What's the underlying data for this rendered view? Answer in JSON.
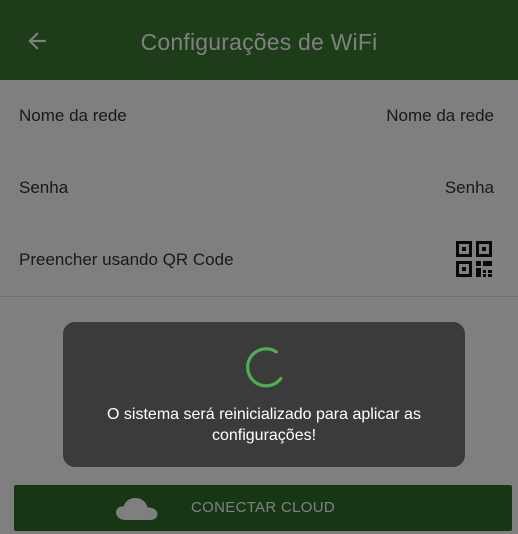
{
  "app_bar": {
    "title": "Configurações de WiFi",
    "back_icon": "arrow-left-icon"
  },
  "form": {
    "network_name": {
      "label": "Nome da rede",
      "placeholder": "Nome da rede"
    },
    "password": {
      "label": "Senha",
      "placeholder": "Senha"
    },
    "qr_fill": {
      "label": "Preencher usando QR Code",
      "icon": "qr-code-icon"
    }
  },
  "cloud_button": {
    "label": "CONECTAR CLOUD",
    "icon": "cloud-icon"
  },
  "dialog": {
    "message": "O sistema será reinicializado para aplicar as configurações!",
    "spinner_icon": "loading-spinner-icon"
  },
  "colors": {
    "primary": "#3a7a32",
    "spinner": "#4caf50",
    "dialog": "#3b3b3b"
  }
}
